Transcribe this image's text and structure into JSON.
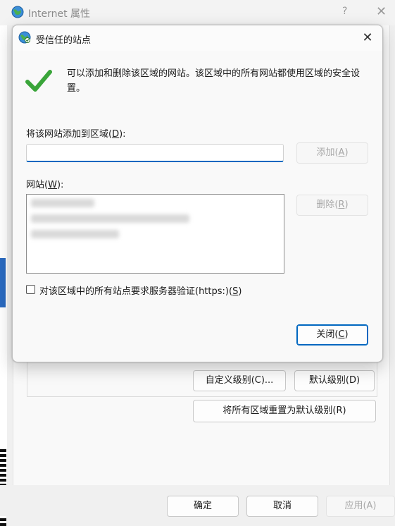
{
  "background_window": {
    "title": "Internet 属性",
    "help_glyph": "?",
    "close_glyph": "✕",
    "buttons": {
      "custom_level": "自定义级别(C)...",
      "default_level": "默认级别(D)",
      "reset_all": "将所有区域重置为默认级别(R)"
    },
    "footer": {
      "ok": "确定",
      "cancel": "取消",
      "apply": "应用(A)"
    }
  },
  "dialog": {
    "title": "受信任的站点",
    "close_glyph": "✕",
    "info_text": "可以添加和删除该区域的网站。该区域中的所有网站都使用区域的安全设置。",
    "add_label_pre": "将该网站添加到区域(",
    "add_label_key": "D",
    "add_label_post": "):",
    "add_input_value": "",
    "add_button_pre": "添加(",
    "add_button_key": "A",
    "add_button_post": ")",
    "sites_label_pre": "网站(",
    "sites_label_key": "W",
    "sites_label_post": "):",
    "remove_button_pre": "删除(",
    "remove_button_key": "R",
    "remove_button_post": ")",
    "https_checkbox_pre": "对该区域中的所有站点要求服务器验证(https:)(",
    "https_checkbox_key": "S",
    "https_checkbox_post": ")",
    "https_checked": false,
    "close_button_pre": "关闭(",
    "close_button_key": "C",
    "close_button_post": ")"
  },
  "colors": {
    "accent": "#0067c0",
    "check_green": "#3aa53a"
  },
  "icons": {
    "window_icon": "globe-icon",
    "success_icon": "checkmark-icon"
  }
}
